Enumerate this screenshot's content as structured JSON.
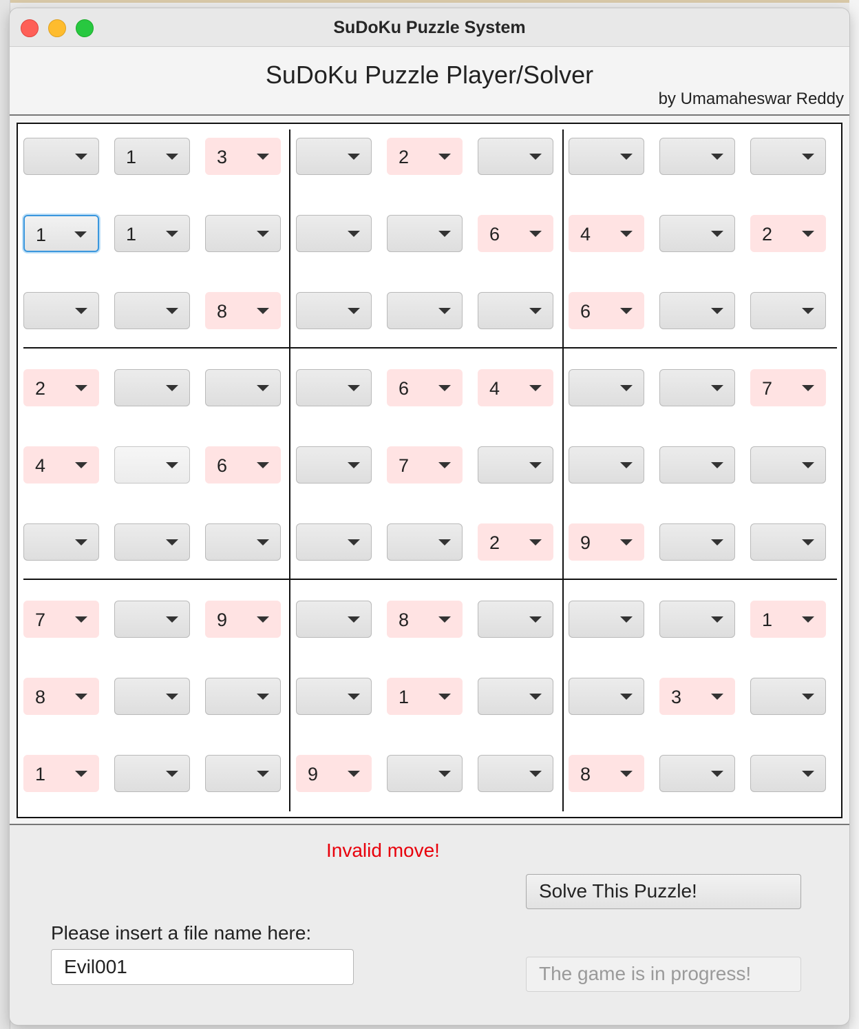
{
  "window": {
    "title": "SuDoKu Puzzle System"
  },
  "header": {
    "title": "SuDoKu Puzzle Player/Solver",
    "author": "by Umamaheswar Reddy"
  },
  "grid": {
    "rows": [
      [
        {
          "value": "",
          "given": false
        },
        {
          "value": "1",
          "given": false
        },
        {
          "value": "3",
          "given": true
        },
        {
          "value": "",
          "given": false
        },
        {
          "value": "2",
          "given": true
        },
        {
          "value": "",
          "given": false
        },
        {
          "value": "",
          "given": false
        },
        {
          "value": "",
          "given": false
        },
        {
          "value": "",
          "given": false
        }
      ],
      [
        {
          "value": "1",
          "given": false,
          "focused": true
        },
        {
          "value": "1",
          "given": false
        },
        {
          "value": "",
          "given": false
        },
        {
          "value": "",
          "given": false
        },
        {
          "value": "",
          "given": false
        },
        {
          "value": "6",
          "given": true
        },
        {
          "value": "4",
          "given": true
        },
        {
          "value": "",
          "given": false
        },
        {
          "value": "2",
          "given": true
        }
      ],
      [
        {
          "value": "",
          "given": false
        },
        {
          "value": "",
          "given": false
        },
        {
          "value": "8",
          "given": true
        },
        {
          "value": "",
          "given": false
        },
        {
          "value": "",
          "given": false
        },
        {
          "value": "",
          "given": false
        },
        {
          "value": "6",
          "given": true
        },
        {
          "value": "",
          "given": false
        },
        {
          "value": "",
          "given": false
        }
      ],
      [
        {
          "value": "2",
          "given": true
        },
        {
          "value": "",
          "given": false
        },
        {
          "value": "",
          "given": false
        },
        {
          "value": "",
          "given": false
        },
        {
          "value": "6",
          "given": true
        },
        {
          "value": "4",
          "given": true
        },
        {
          "value": "",
          "given": false
        },
        {
          "value": "",
          "given": false
        },
        {
          "value": "7",
          "given": true
        }
      ],
      [
        {
          "value": "4",
          "given": true
        },
        {
          "value": "",
          "given": false,
          "plain": true
        },
        {
          "value": "6",
          "given": true
        },
        {
          "value": "",
          "given": false
        },
        {
          "value": "7",
          "given": true
        },
        {
          "value": "",
          "given": false
        },
        {
          "value": "",
          "given": false
        },
        {
          "value": "",
          "given": false
        },
        {
          "value": "",
          "given": false
        }
      ],
      [
        {
          "value": "",
          "given": false
        },
        {
          "value": "",
          "given": false
        },
        {
          "value": "",
          "given": false
        },
        {
          "value": "",
          "given": false
        },
        {
          "value": "",
          "given": false
        },
        {
          "value": "2",
          "given": true
        },
        {
          "value": "9",
          "given": true
        },
        {
          "value": "",
          "given": false
        },
        {
          "value": "",
          "given": false
        }
      ],
      [
        {
          "value": "7",
          "given": true
        },
        {
          "value": "",
          "given": false
        },
        {
          "value": "9",
          "given": true
        },
        {
          "value": "",
          "given": false
        },
        {
          "value": "8",
          "given": true
        },
        {
          "value": "",
          "given": false
        },
        {
          "value": "",
          "given": false
        },
        {
          "value": "",
          "given": false
        },
        {
          "value": "1",
          "given": true
        }
      ],
      [
        {
          "value": "8",
          "given": true
        },
        {
          "value": "",
          "given": false
        },
        {
          "value": "",
          "given": false
        },
        {
          "value": "",
          "given": false
        },
        {
          "value": "1",
          "given": true
        },
        {
          "value": "",
          "given": false
        },
        {
          "value": "",
          "given": false
        },
        {
          "value": "3",
          "given": true
        },
        {
          "value": "",
          "given": false
        }
      ],
      [
        {
          "value": "1",
          "given": true
        },
        {
          "value": "",
          "given": false
        },
        {
          "value": "",
          "given": false
        },
        {
          "value": "9",
          "given": true
        },
        {
          "value": "",
          "given": false
        },
        {
          "value": "",
          "given": false
        },
        {
          "value": "8",
          "given": true
        },
        {
          "value": "",
          "given": false
        },
        {
          "value": "",
          "given": false
        }
      ]
    ]
  },
  "status": {
    "message": "Invalid move!",
    "color": "#e8000b"
  },
  "controls": {
    "solve_label": "Solve This Puzzle!",
    "file_label": "Please insert a file name here:",
    "file_value": "Evil001",
    "progress_label": "The game is in progress!"
  },
  "colors": {
    "given_cell": "#ffe3e3",
    "focus_ring": "#3a96dd"
  }
}
